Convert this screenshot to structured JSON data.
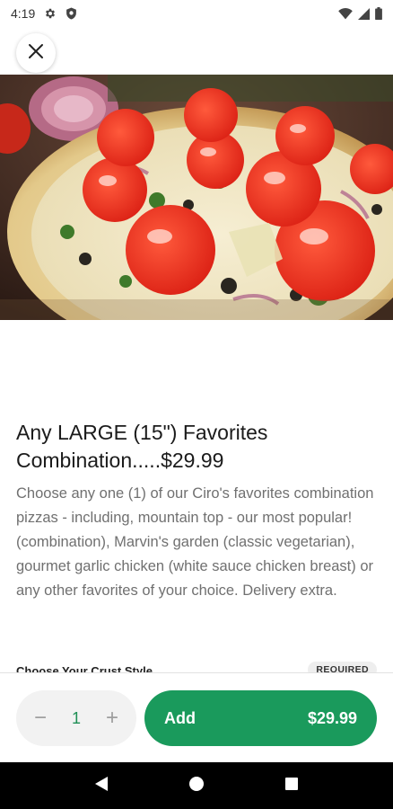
{
  "status_bar": {
    "time": "4:19"
  },
  "item": {
    "title": "Any LARGE (15\") Favorites Combination.....$29.99",
    "description": "Choose any one (1) of our Ciro's favorites combination pizzas - including, mountain top - our most popular! (combination), Marvin's garden (classic vegetarian), gourmet garlic chicken (white sauce chicken breast) or any other favorites of your choice. Delivery extra."
  },
  "option": {
    "label": "Choose Your Crust Style",
    "badge": "REQUIRED"
  },
  "action_bar": {
    "quantity": "1",
    "minus": "−",
    "plus": "+",
    "add_label": "Add",
    "add_price": "$29.99"
  },
  "colors": {
    "accent": "#1a9a5c",
    "quantity_text": "#1f8f55"
  }
}
